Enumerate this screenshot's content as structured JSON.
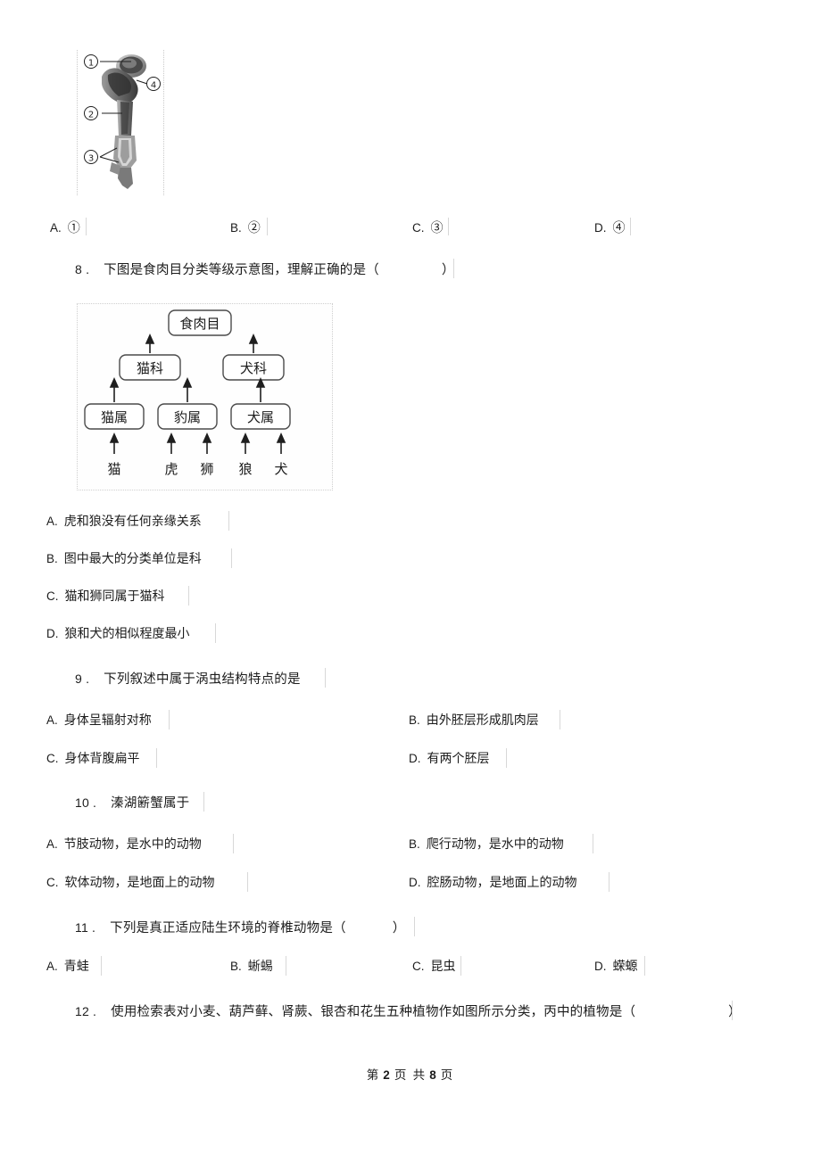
{
  "page": {
    "footer_prefix": "第",
    "footer_current": "2",
    "footer_mid": "页 共",
    "footer_total": "8",
    "footer_suffix": "页"
  },
  "questions": [
    {
      "id": "q7",
      "number": "",
      "stem": "",
      "figure": "bone-joint-diagram",
      "figure_labels": [
        "①",
        "②",
        "③",
        "④"
      ],
      "options": [
        {
          "label": "A.",
          "text": "①"
        },
        {
          "label": "B.",
          "text": "②"
        },
        {
          "label": "C.",
          "text": "③"
        },
        {
          "label": "D.",
          "text": "④"
        }
      ]
    },
    {
      "id": "q8",
      "number": "8 .",
      "stem": "下图是食肉目分类等级示意图，理解正确的是（",
      "stem_close": "）",
      "figure": "carnivora-taxonomy-diagram",
      "options": [
        {
          "label": "A.",
          "text": "虎和狼没有任何亲缘关系"
        },
        {
          "label": "B.",
          "text": "图中最大的分类单位是科"
        },
        {
          "label": "C.",
          "text": "猫和狮同属于猫科"
        },
        {
          "label": "D.",
          "text": "狼和犬的相似程度最小"
        }
      ]
    },
    {
      "id": "q9",
      "number": "9 .",
      "stem": "下列叙述中属于涡虫结构特点的是",
      "options": [
        {
          "label": "A.",
          "text": "身体呈辐射对称"
        },
        {
          "label": "B.",
          "text": "由外胚层形成肌肉层"
        },
        {
          "label": "C.",
          "text": "身体背腹扁平"
        },
        {
          "label": "D.",
          "text": "有两个胚层"
        }
      ]
    },
    {
      "id": "q10",
      "number": "10 .",
      "stem": "溱湖簖蟹属于",
      "options": [
        {
          "label": "A.",
          "text": "节肢动物，是水中的动物"
        },
        {
          "label": "B.",
          "text": "爬行动物，是水中的动物"
        },
        {
          "label": "C.",
          "text": "软体动物，是地面上的动物"
        },
        {
          "label": "D.",
          "text": "腔肠动物，是地面上的动物"
        }
      ]
    },
    {
      "id": "q11",
      "number": "11 .",
      "stem": "下列是真正适应陆生环境的脊椎动物是（",
      "stem_close": "）",
      "options": [
        {
          "label": "A.",
          "text": "青蛙"
        },
        {
          "label": "B.",
          "text": "蜥蜴"
        },
        {
          "label": "C.",
          "text": "昆虫"
        },
        {
          "label": "D.",
          "text": "蝾螈"
        }
      ]
    },
    {
      "id": "q12",
      "number": "12 .",
      "stem": "使用检索表对小麦、葫芦藓、肾蕨、银杏和花生五种植物作如图所示分类，丙中的植物是（",
      "stem_close": "）",
      "options": []
    }
  ],
  "taxonomy_diagram": {
    "order": "食肉目",
    "families": [
      "猫科",
      "犬科"
    ],
    "genera": [
      "猫属",
      "豹属",
      "犬属"
    ],
    "species": [
      "猫",
      "虎",
      "狮",
      "狼",
      "犬"
    ]
  },
  "bone_diagram": {
    "labels": [
      "①",
      "②",
      "③",
      "④"
    ]
  }
}
